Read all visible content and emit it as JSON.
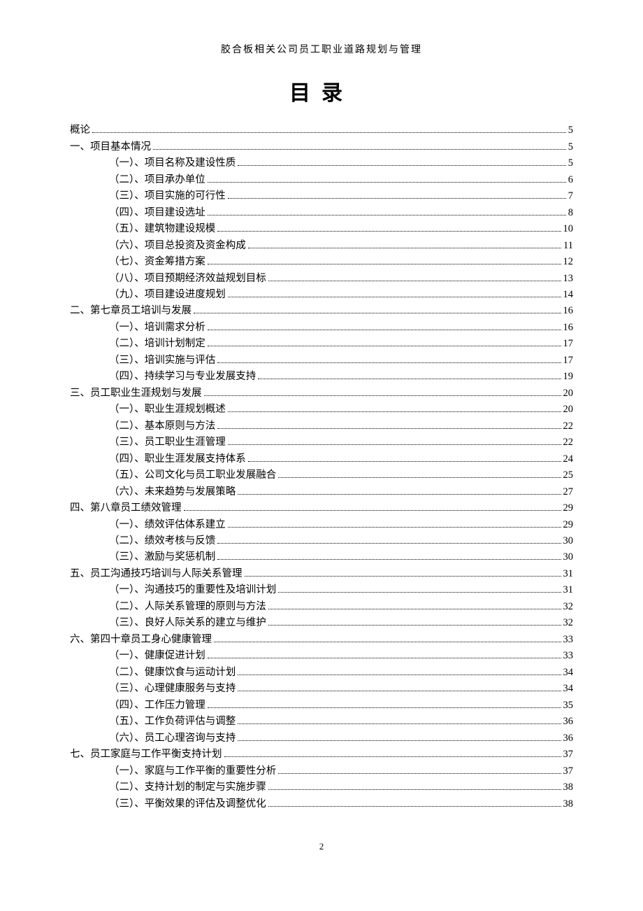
{
  "header": "胶合板相关公司员工职业道路规划与管理",
  "title": "目录",
  "page_number": "2",
  "toc": [
    {
      "level": 0,
      "label": "概论",
      "page": "5"
    },
    {
      "level": 1,
      "label": "一、项目基本情况",
      "page": "5"
    },
    {
      "level": 2,
      "label": "（一）、项目名称及建设性质",
      "page": "5"
    },
    {
      "level": 2,
      "label": "（二）、项目承办单位",
      "page": "6"
    },
    {
      "level": 2,
      "label": "（三）、项目实施的可行性",
      "page": "7"
    },
    {
      "level": 2,
      "label": "（四）、项目建设选址",
      "page": "8"
    },
    {
      "level": 2,
      "label": "（五）、建筑物建设规模",
      "page": "10"
    },
    {
      "level": 2,
      "label": "（六）、项目总投资及资金构成",
      "page": "11"
    },
    {
      "level": 2,
      "label": "（七）、资金筹措方案",
      "page": "12"
    },
    {
      "level": 2,
      "label": "（八）、项目预期经济效益规划目标",
      "page": "13"
    },
    {
      "level": 2,
      "label": "（九）、项目建设进度规划",
      "page": "14"
    },
    {
      "level": 1,
      "label": "二、第七章员工培训与发展",
      "page": "16"
    },
    {
      "level": 2,
      "label": "（一）、培训需求分析",
      "page": "16"
    },
    {
      "level": 2,
      "label": "（二）、培训计划制定",
      "page": "17"
    },
    {
      "level": 2,
      "label": "（三）、培训实施与评估",
      "page": "17"
    },
    {
      "level": 2,
      "label": "（四）、持续学习与专业发展支持",
      "page": "19"
    },
    {
      "level": 1,
      "label": "三、员工职业生涯规划与发展",
      "page": "20"
    },
    {
      "level": 2,
      "label": "（一）、职业生涯规划概述",
      "page": "20"
    },
    {
      "level": 2,
      "label": "（二）、基本原则与方法",
      "page": "22"
    },
    {
      "level": 2,
      "label": "（三）、员工职业生涯管理",
      "page": "22"
    },
    {
      "level": 2,
      "label": "（四）、职业生涯发展支持体系",
      "page": "24"
    },
    {
      "level": 2,
      "label": "（五）、公司文化与员工职业发展融合",
      "page": "25"
    },
    {
      "level": 2,
      "label": "（六）、未来趋势与发展策略",
      "page": "27"
    },
    {
      "level": 1,
      "label": "四、第八章员工绩效管理",
      "page": "29"
    },
    {
      "level": 2,
      "label": "（一）、绩效评估体系建立",
      "page": "29"
    },
    {
      "level": 2,
      "label": "（二）、绩效考核与反馈",
      "page": "30"
    },
    {
      "level": 2,
      "label": "（三）、激励与奖惩机制",
      "page": "30"
    },
    {
      "level": 1,
      "label": "五、员工沟通技巧培训与人际关系管理",
      "page": "31"
    },
    {
      "level": 2,
      "label": "（一）、沟通技巧的重要性及培训计划",
      "page": "31"
    },
    {
      "level": 2,
      "label": "（二）、人际关系管理的原则与方法",
      "page": "32"
    },
    {
      "level": 2,
      "label": "（三）、良好人际关系的建立与维护",
      "page": "32"
    },
    {
      "level": 1,
      "label": "六、第四十章员工身心健康管理",
      "page": "33"
    },
    {
      "level": 2,
      "label": "（一）、健康促进计划",
      "page": "33"
    },
    {
      "level": 2,
      "label": "（二）、健康饮食与运动计划",
      "page": "34"
    },
    {
      "level": 2,
      "label": "（三）、心理健康服务与支持",
      "page": "34"
    },
    {
      "level": 2,
      "label": "（四）、工作压力管理",
      "page": "35"
    },
    {
      "level": 2,
      "label": "（五）、工作负荷评估与调整",
      "page": "36"
    },
    {
      "level": 2,
      "label": "（六）、员工心理咨询与支持",
      "page": "36"
    },
    {
      "level": 1,
      "label": "七、员工家庭与工作平衡支持计划",
      "page": "37"
    },
    {
      "level": 2,
      "label": "（一）、家庭与工作平衡的重要性分析",
      "page": "37"
    },
    {
      "level": 2,
      "label": "（二）、支持计划的制定与实施步骤",
      "page": "38"
    },
    {
      "level": 2,
      "label": "（三）、平衡效果的评估及调整优化",
      "page": "38"
    }
  ]
}
